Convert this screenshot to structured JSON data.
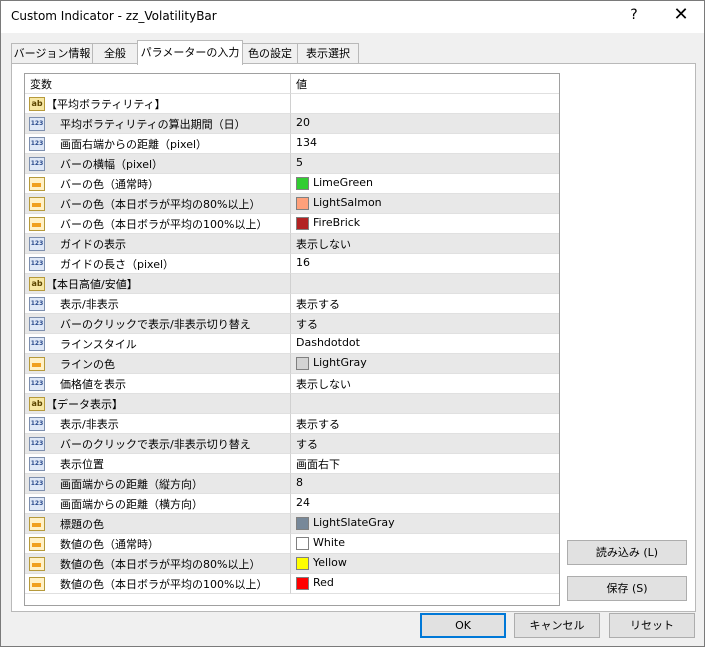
{
  "window": {
    "title": "Custom Indicator - zz_VolatilityBar",
    "help_label": "?",
    "close_label": "✕"
  },
  "tabs": [
    {
      "label": "バージョン情報",
      "active": false
    },
    {
      "label": "全般",
      "active": false
    },
    {
      "label": "パラメーターの入力",
      "active": true
    },
    {
      "label": "色の設定",
      "active": false
    },
    {
      "label": "表示選択",
      "active": false
    }
  ],
  "grid": {
    "header": {
      "name": "変数",
      "value": "値"
    },
    "rows": [
      {
        "type": "section",
        "icon": "ab",
        "name": "【平均ボラティリティ】",
        "value": ""
      },
      {
        "type": "int",
        "icon": "123",
        "name": "平均ボラティリティの算出期間（日）",
        "value": "20"
      },
      {
        "type": "int",
        "icon": "123",
        "name": "画面右端からの距離（pixel）",
        "value": "134"
      },
      {
        "type": "int",
        "icon": "123",
        "name": "バーの横幅（pixel）",
        "value": "5"
      },
      {
        "type": "color",
        "icon": "color",
        "name": "バーの色（通常時）",
        "value": "LimeGreen",
        "swatch": "#32cd32"
      },
      {
        "type": "color",
        "icon": "color",
        "name": "バーの色（本日ボラが平均の80%以上）",
        "value": "LightSalmon",
        "swatch": "#ffa07a"
      },
      {
        "type": "color",
        "icon": "color",
        "name": "バーの色（本日ボラが平均の100%以上）",
        "value": "FireBrick",
        "swatch": "#b22222"
      },
      {
        "type": "int",
        "icon": "123",
        "name": "ガイドの表示",
        "value": "表示しない"
      },
      {
        "type": "int",
        "icon": "123",
        "name": "ガイドの長さ（pixel）",
        "value": "16"
      },
      {
        "type": "section",
        "icon": "ab",
        "name": "【本日高値/安値】",
        "value": ""
      },
      {
        "type": "int",
        "icon": "123",
        "name": "表示/非表示",
        "value": "表示する"
      },
      {
        "type": "int",
        "icon": "123",
        "name": "バーのクリックで表示/非表示切り替え",
        "value": "する"
      },
      {
        "type": "int",
        "icon": "123",
        "name": "ラインスタイル",
        "value": "Dashdotdot"
      },
      {
        "type": "color",
        "icon": "color",
        "name": "ラインの色",
        "value": "LightGray",
        "swatch": "#d3d3d3"
      },
      {
        "type": "int",
        "icon": "123",
        "name": "価格値を表示",
        "value": "表示しない"
      },
      {
        "type": "section",
        "icon": "ab",
        "name": "【データ表示】",
        "value": ""
      },
      {
        "type": "int",
        "icon": "123",
        "name": "表示/非表示",
        "value": "表示する"
      },
      {
        "type": "int",
        "icon": "123",
        "name": "バーのクリックで表示/非表示切り替え",
        "value": "する"
      },
      {
        "type": "int",
        "icon": "123",
        "name": "表示位置",
        "value": "画面右下"
      },
      {
        "type": "int",
        "icon": "123",
        "name": "画面端からの距離（縦方向）",
        "value": "8"
      },
      {
        "type": "int",
        "icon": "123",
        "name": "画面端からの距離（横方向）",
        "value": "24"
      },
      {
        "type": "color",
        "icon": "color",
        "name": "標題の色",
        "value": "LightSlateGray",
        "swatch": "#778899"
      },
      {
        "type": "color",
        "icon": "color",
        "name": "数値の色（通常時）",
        "value": "White",
        "swatch": "#ffffff"
      },
      {
        "type": "color",
        "icon": "color",
        "name": "数値の色（本日ボラが平均の80%以上）",
        "value": "Yellow",
        "swatch": "#ffff00"
      },
      {
        "type": "color",
        "icon": "color",
        "name": "数値の色（本日ボラが平均の100%以上）",
        "value": "Red",
        "swatch": "#ff0000"
      }
    ]
  },
  "buttons": {
    "load": "読み込み (L)",
    "save": "保存 (S)",
    "ok": "OK",
    "cancel": "キャンセル",
    "reset": "リセット"
  }
}
